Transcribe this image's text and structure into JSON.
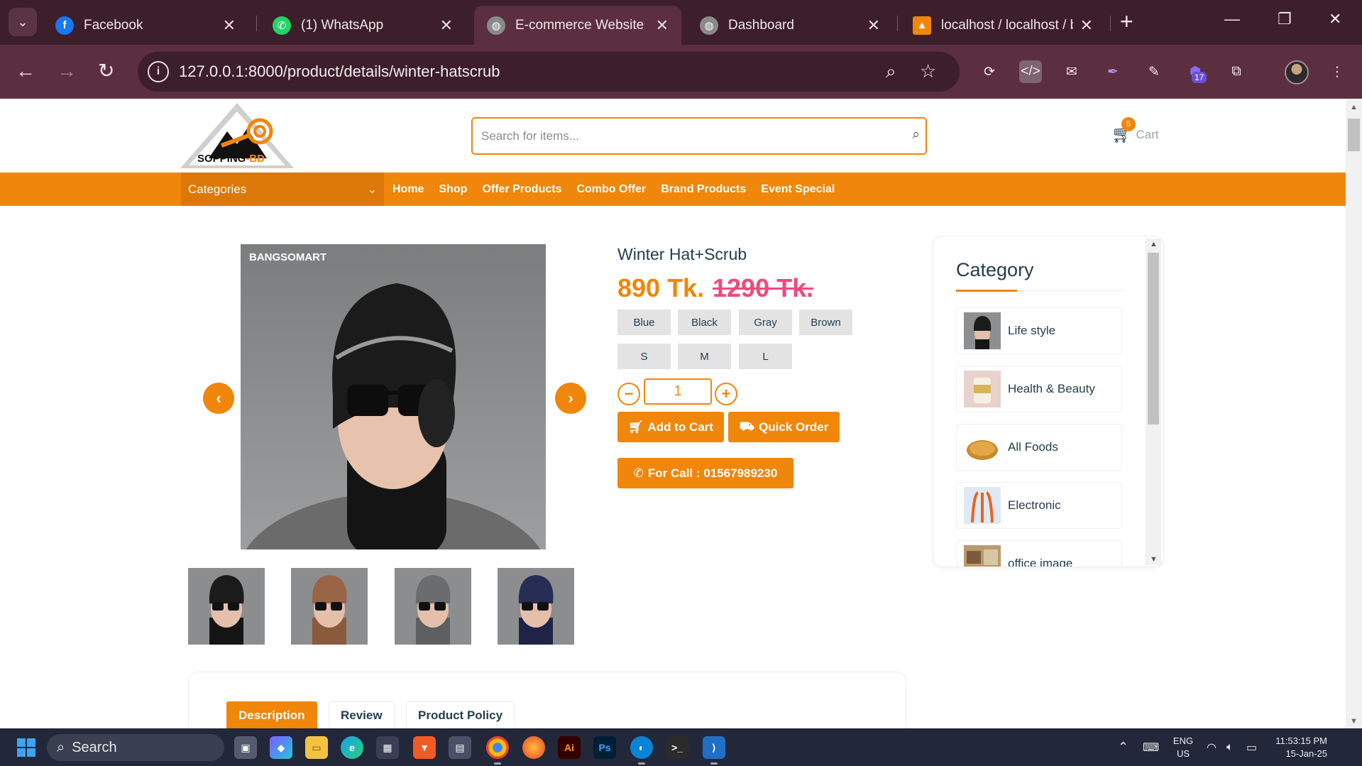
{
  "browser": {
    "tabs": [
      {
        "title": "Facebook",
        "icon": "facebook-icon",
        "color": "#1877f2",
        "active": false
      },
      {
        "title": "(1) WhatsApp",
        "icon": "whatsapp-icon",
        "color": "#25d366",
        "active": false
      },
      {
        "title": "E-commerce Website",
        "icon": "globe-icon",
        "color": "#8a8a8a",
        "active": true
      },
      {
        "title": "Dashboard",
        "icon": "globe-icon",
        "color": "#8a8a8a",
        "active": false
      },
      {
        "title": "localhost / localhost / b",
        "icon": "phpmyadmin-icon",
        "color": "#f0860a",
        "active": false
      }
    ],
    "url": "127.0.0.1:8000/product/details/winter-hatscrub",
    "extension_badge": "17"
  },
  "site": {
    "logo_text_main": "SOPPING",
    "logo_text_accent": "-BD",
    "search_placeholder": "Search for items...",
    "cart_label": "Cart",
    "cart_count": "5",
    "categories_label": "Categories",
    "menu": [
      "Home",
      "Shop",
      "Offer Products",
      "Combo Offer",
      "Brand Products",
      "Event Special"
    ],
    "brand_color": "#f0860a"
  },
  "product": {
    "watermark": "BANGSOMART",
    "title": "Winter Hat+Scrub",
    "price": "890 Tk.",
    "old_price": "1290 Tk.",
    "colors": [
      "Blue",
      "Black",
      "Gray",
      "Brown"
    ],
    "sizes": [
      "S",
      "M",
      "L"
    ],
    "quantity": "1",
    "add_to_cart": "Add to Cart",
    "quick_order": "Quick Order",
    "call": "For Call : 01567989230",
    "thumbnails": [
      "black",
      "brown",
      "gray",
      "navy"
    ]
  },
  "sidebar": {
    "title": "Category",
    "items": [
      {
        "label": "Life style"
      },
      {
        "label": "Health & Beauty"
      },
      {
        "label": "All Foods"
      },
      {
        "label": "Electronic"
      },
      {
        "label": "office image"
      }
    ]
  },
  "detail_tabs": [
    "Description",
    "Review",
    "Product Policy"
  ],
  "taskbar": {
    "search_label": "Search",
    "lang_top": "ENG",
    "lang_bottom": "US",
    "time": "11:53:15 PM",
    "date": "15-Jan-25"
  }
}
